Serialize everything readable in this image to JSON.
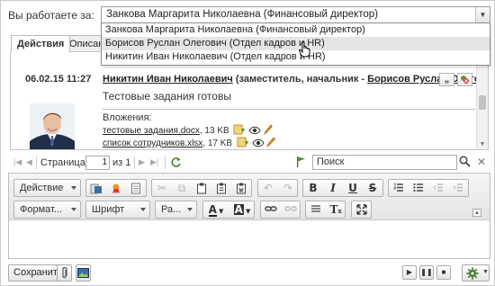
{
  "header": {
    "who_label": "Вы работаете за:",
    "selected": "Занкова Маргарита Николаевна (Финансовый директор)",
    "options": [
      "Занкова Маргарита Николаевна (Финансовый директор)",
      "Борисов Руслан Олегович (Отдел кадров и HR)",
      "Никитин Иван Николаевич (Отдел кадров и HR)"
    ],
    "hovered_index": 1
  },
  "tabs": [
    {
      "label": "Действия",
      "active": true
    },
    {
      "label": "Описани",
      "active": false
    }
  ],
  "message": {
    "date": "06.02.15 11:27",
    "sender_name": "Никитин Иван Николаевич",
    "sender_mid": " (заместитель, начальник - ",
    "boss_name": "Борисов Руслан Олегович",
    "sender_end": ")",
    "quote_label": "„",
    "text": "Тестовые задания готовы",
    "attachments_label": "Вложения:",
    "attachments": [
      {
        "name": "тестовые задания.docx",
        "size": ", 13 KB"
      },
      {
        "name": "список сотрудников.xlsx",
        "size": ", 17 KB"
      }
    ]
  },
  "pager": {
    "page_label": "Страница",
    "page_value": "1",
    "of_label": "из 1",
    "search_placeholder": "Поиск"
  },
  "toolbar": {
    "action_label": "Действие",
    "format_label": "Формат...",
    "font_label": "Шрифт",
    "size_label": "Ра...",
    "bold": "B",
    "italic": "I",
    "underline": "U",
    "strike": "S",
    "font_color": "A",
    "bg_color": "A",
    "clear_format": "T"
  },
  "footer": {
    "save_label": "Сохранить"
  },
  "colors": {
    "accent_orange": "#e8941f",
    "icon_green": "#3a9a2a",
    "icon_blue": "#3c6ea6"
  }
}
